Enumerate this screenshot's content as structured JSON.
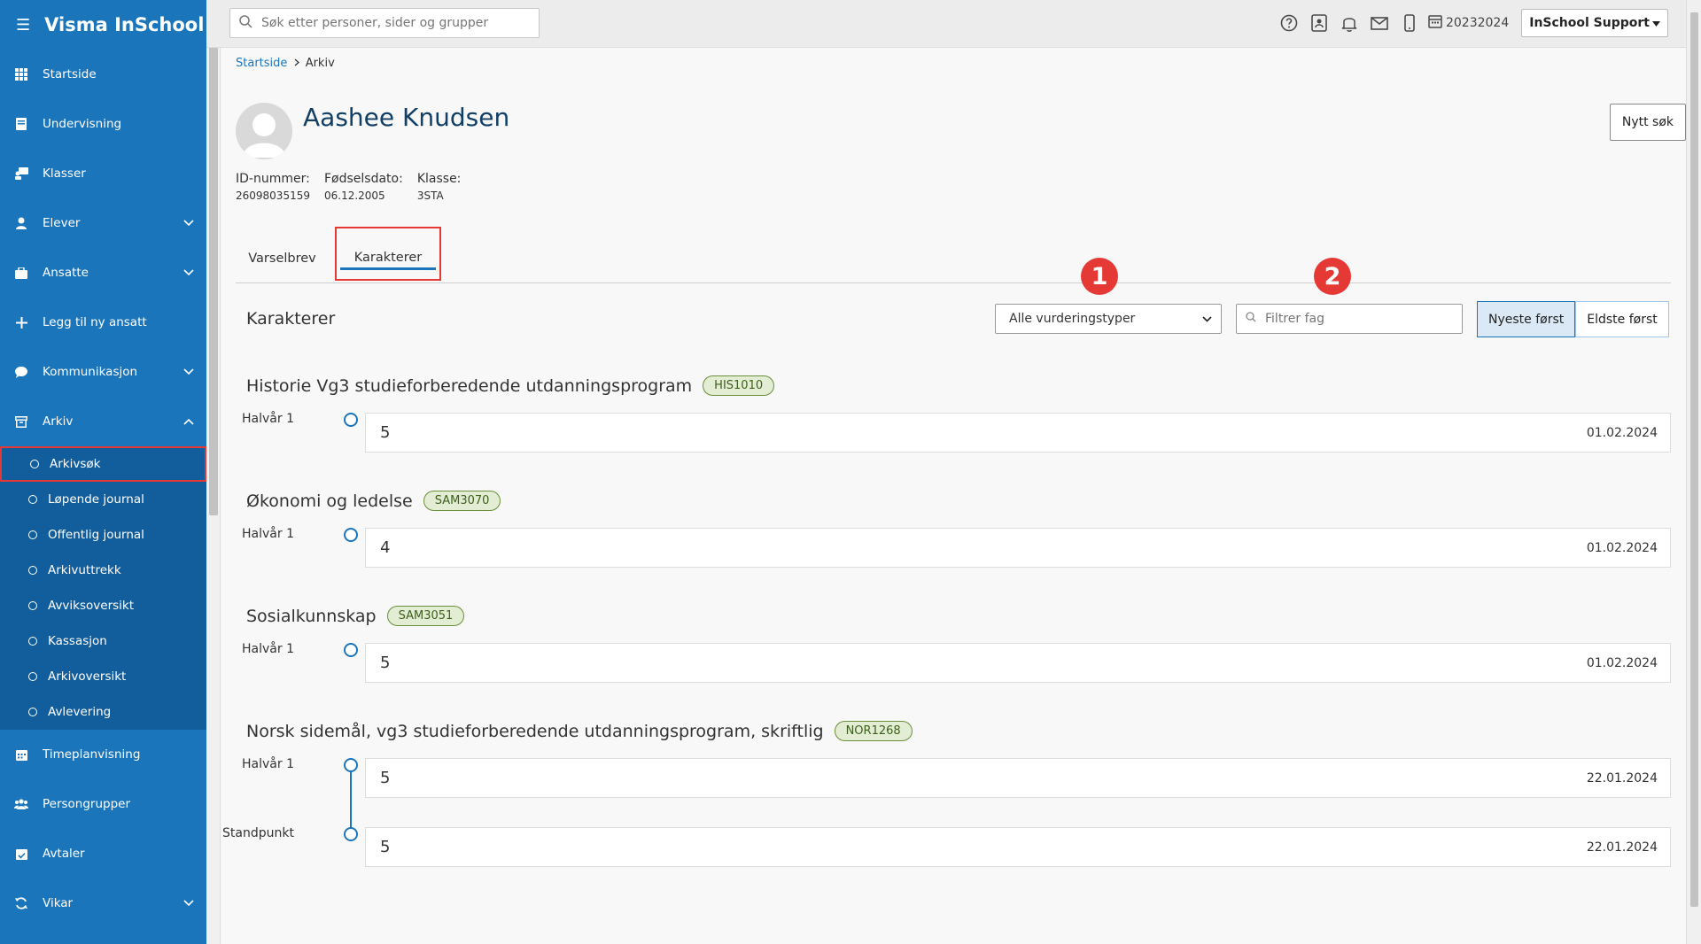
{
  "app": {
    "brand": "Visma InSchool"
  },
  "sidebar": {
    "items": [
      {
        "label": "Startside",
        "icon": "grid-icon"
      },
      {
        "label": "Undervisning",
        "icon": "book-icon"
      },
      {
        "label": "Klasser",
        "icon": "classroom-icon"
      },
      {
        "label": "Elever",
        "icon": "student-icon"
      },
      {
        "label": "Ansatte",
        "icon": "briefcase-icon"
      },
      {
        "label": "Legg til ny ansatt",
        "icon": "plus-icon"
      },
      {
        "label": "Kommunikasjon",
        "icon": "chat-icon"
      },
      {
        "label": "Arkiv",
        "icon": "archive-icon"
      }
    ],
    "arkiv_sub": [
      "Arkivsøk",
      "Løpende journal",
      "Offentlig journal",
      "Arkivuttrekk",
      "Avviksoversikt",
      "Kassasjon",
      "Arkivoversikt",
      "Avlevering"
    ],
    "bottom_items": [
      {
        "label": "Timeplanvisning",
        "icon": "calendar-icon"
      },
      {
        "label": "Persongrupper",
        "icon": "people-icon"
      },
      {
        "label": "Avtaler",
        "icon": "calendar-check-icon"
      },
      {
        "label": "Vikar",
        "icon": "refresh-icon"
      }
    ]
  },
  "topbar": {
    "search_placeholder": "Søk etter personer, sider og grupper",
    "term": "20232024",
    "user": "InSchool Support"
  },
  "breadcrumb": {
    "home": "Startside",
    "current": "Arkiv"
  },
  "student": {
    "name": "Aashee Knudsen",
    "id_label": "ID-nummer:",
    "id_value": "26098035159",
    "dob_label": "Fødselsdato:",
    "dob_value": "06.12.2005",
    "class_label": "Klasse:",
    "class_value": "3STA"
  },
  "buttons": {
    "new_search": "Nytt søk"
  },
  "tabs": [
    "Varselbrev",
    "Karakterer"
  ],
  "section": {
    "title": "Karakterer",
    "assessment_type": "Alle vurderingstyper",
    "filter_placeholder": "Filtrer fag",
    "sort_newest": "Nyeste først",
    "sort_oldest": "Eldste først",
    "markers": [
      "1",
      "2"
    ]
  },
  "courses": [
    {
      "name": "Historie Vg3 studieforberedende utdanningsprogram",
      "code": "HIS1010",
      "grades": [
        {
          "label": "Halvår 1",
          "value": "5",
          "date": "01.02.2024"
        }
      ]
    },
    {
      "name": "Økonomi og ledelse",
      "code": "SAM3070",
      "grades": [
        {
          "label": "Halvår 1",
          "value": "4",
          "date": "01.02.2024"
        }
      ]
    },
    {
      "name": "Sosialkunnskap",
      "code": "SAM3051",
      "grades": [
        {
          "label": "Halvår 1",
          "value": "5",
          "date": "01.02.2024"
        }
      ]
    },
    {
      "name": "Norsk sidemål, vg3 studieforberedende utdanningsprogram, skriftlig",
      "code": "NOR1268",
      "grades": [
        {
          "label": "Halvår 1",
          "value": "5",
          "date": "22.01.2024"
        },
        {
          "label": "Standpunkt",
          "value": "5",
          "date": "22.01.2024"
        }
      ]
    }
  ]
}
